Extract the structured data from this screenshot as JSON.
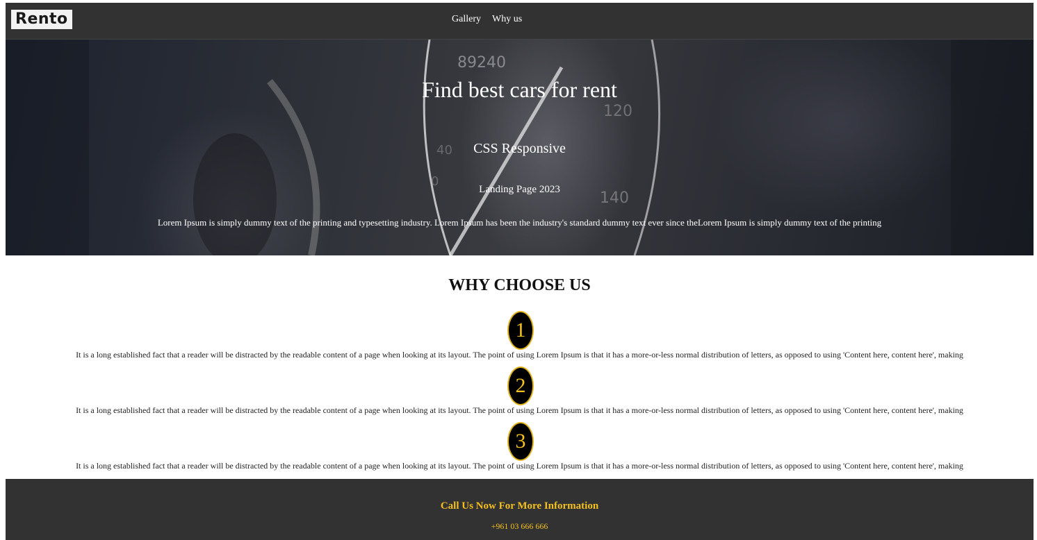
{
  "navbar": {
    "logo": "Rento",
    "links": [
      {
        "label": "Gallery"
      },
      {
        "label": "Why us"
      }
    ]
  },
  "hero": {
    "title": "Find best cars for rent",
    "subtitle": "CSS Responsive",
    "tagline": "Landing Page 2023",
    "description": "Lorem Ipsum is simply dummy text of the printing and typesetting industry. Lorem Ipsum has been the industry's standard dummy text ever since theLorem Ipsum is simply dummy text of the printing"
  },
  "why": {
    "title": "WHY CHOOSE US",
    "reasons": [
      {
        "number": "1",
        "text": "It is a long established fact that a reader will be distracted by the readable content of a page when looking at its layout. The point of using Lorem Ipsum is that it has a more-or-less normal distribution of letters, as opposed to using 'Content here, content here', making"
      },
      {
        "number": "2",
        "text": "It is a long established fact that a reader will be distracted by the readable content of a page when looking at its layout. The point of using Lorem Ipsum is that it has a more-or-less normal distribution of letters, as opposed to using 'Content here, content here', making"
      },
      {
        "number": "3",
        "text": "It is a long established fact that a reader will be distracted by the readable content of a page when looking at its layout. The point of using Lorem Ipsum is that it has a more-or-less normal distribution of letters, as opposed to using 'Content here, content here', making"
      }
    ]
  },
  "footer": {
    "title": "Call Us Now For More Information",
    "phone": "+961 03 666 666"
  },
  "colors": {
    "dark": "#323232",
    "accent": "#f3c01f"
  }
}
